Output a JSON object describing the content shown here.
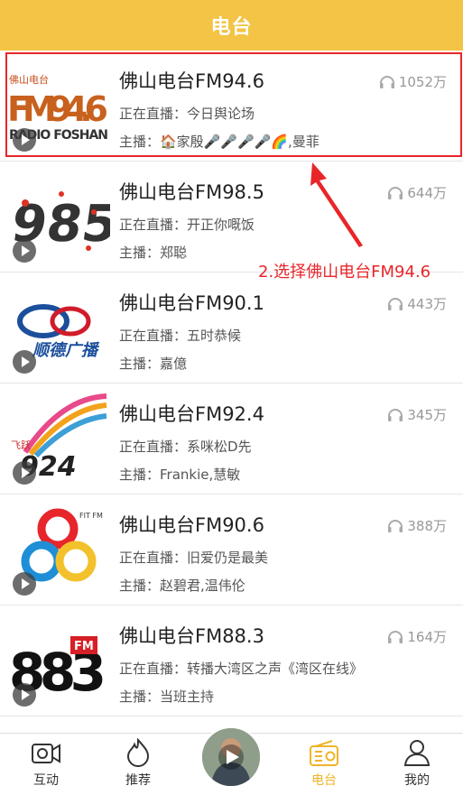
{
  "header": {
    "title": "电台"
  },
  "stations": [
    {
      "name": "佛山电台FM94.6",
      "live": "正在直播：今日舆论场",
      "host": "主播：🏠家殷🎤🎤🎤🎤🌈,曼菲",
      "count": "1052万",
      "logo": {
        "top": "佛山电台",
        "main": "FM94.6",
        "sub": "RADIO FOSHAN"
      }
    },
    {
      "name": "佛山电台FM98.5",
      "live": "正在直播：开正你嘅饭",
      "host": "主播：郑聪",
      "count": "644万",
      "logo": {
        "main": "985"
      }
    },
    {
      "name": "佛山电台FM90.1",
      "live": "正在直播：五时恭候",
      "host": "主播：嘉億",
      "count": "443万",
      "logo": {
        "main": "顺德广播"
      }
    },
    {
      "name": "佛山电台FM92.4",
      "live": "正在直播：系咪松D先",
      "host": "主播：Frankie,慧敏",
      "count": "345万",
      "logo": {
        "top": "飞跃",
        "main": "924"
      }
    },
    {
      "name": "佛山电台FM90.6",
      "live": "正在直播：旧爱仍是最美",
      "host": "主播：赵碧君,温伟伦",
      "count": "388万",
      "logo": {
        "top": "FIT FM"
      }
    },
    {
      "name": "佛山电台FM88.3",
      "live": "正在直播：转播大湾区之声《湾区在线》",
      "host": "主播：当班主持",
      "count": "164万",
      "logo": {
        "main": "883",
        "sub": "FM"
      }
    }
  ],
  "annotation": "2.选择佛山电台FM94.6",
  "tabbar": {
    "tabs": [
      {
        "label": "互动",
        "icon": "camera-icon"
      },
      {
        "label": "推荐",
        "icon": "flame-icon"
      },
      {
        "label": "电台",
        "icon": "radio-icon",
        "active": true
      },
      {
        "label": "我的",
        "icon": "person-icon"
      }
    ]
  },
  "colors": {
    "header": "#f3c445",
    "accent": "#f0b429",
    "annotation": "#e8262a"
  }
}
